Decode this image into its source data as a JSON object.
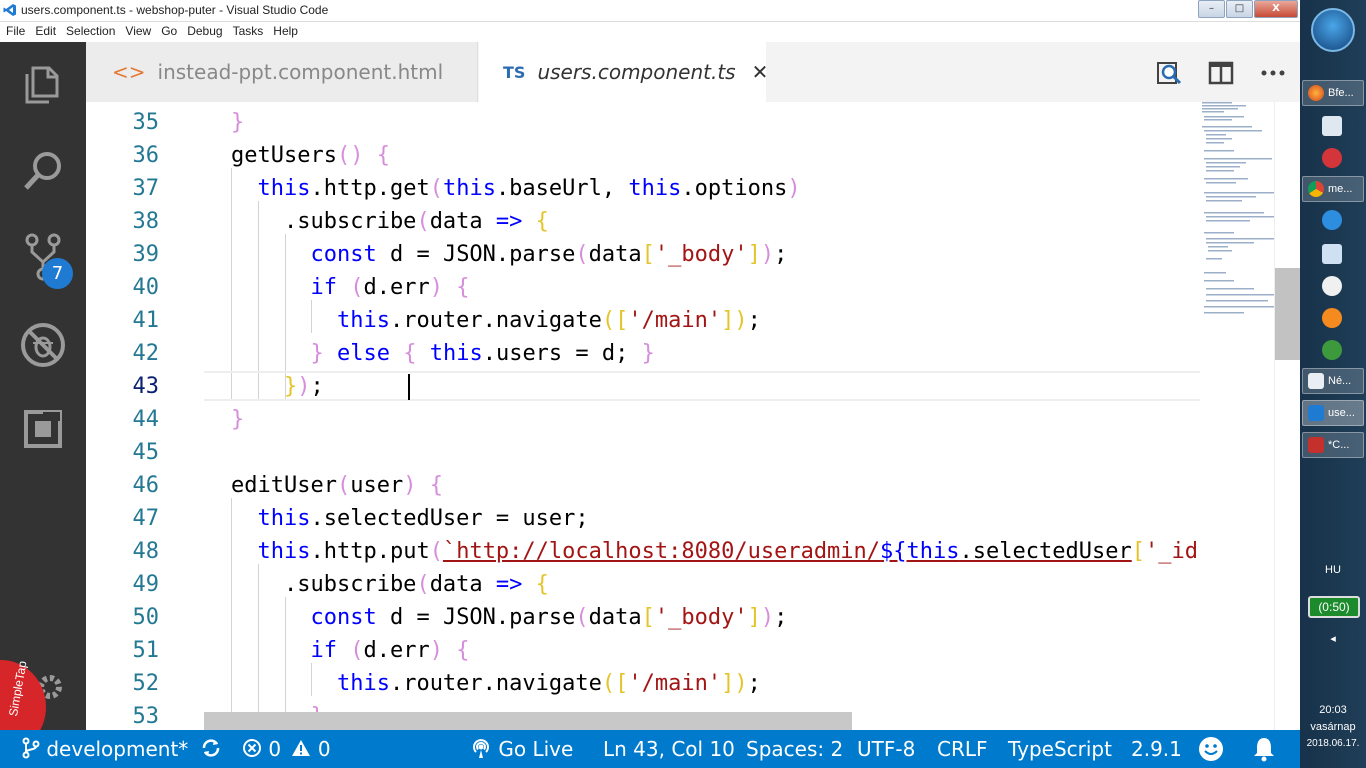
{
  "window": {
    "title": "users.component.ts - webshop-puter - Visual Studio Code",
    "controls": [
      "–",
      "□",
      "X"
    ]
  },
  "menu": [
    "File",
    "Edit",
    "Selection",
    "View",
    "Go",
    "Debug",
    "Tasks",
    "Help"
  ],
  "activity": {
    "scm_badge": "7",
    "simpletap_label": "SimpleTap"
  },
  "tabs": [
    {
      "label": "instead-ppt.component.html",
      "icon": "<>",
      "active": false
    },
    {
      "label": "users.component.ts",
      "icon": "TS",
      "active": true,
      "close": "✕"
    }
  ],
  "editor": {
    "current_line": 43,
    "lines": [
      {
        "n": "35"
      },
      {
        "n": "36"
      },
      {
        "n": "37"
      },
      {
        "n": "38"
      },
      {
        "n": "39"
      },
      {
        "n": "40"
      },
      {
        "n": "41"
      },
      {
        "n": "42"
      },
      {
        "n": "43"
      },
      {
        "n": "44"
      },
      {
        "n": "45"
      },
      {
        "n": "46"
      },
      {
        "n": "47"
      },
      {
        "n": "48"
      },
      {
        "n": "49"
      },
      {
        "n": "50"
      },
      {
        "n": "51"
      },
      {
        "n": "52"
      },
      {
        "n": "53"
      }
    ]
  },
  "status": {
    "branch": "development*",
    "errors": "0",
    "warnings": "0",
    "golive": "Go Live",
    "position": "Ln 43, Col 10",
    "spaces": "Spaces: 2",
    "encoding": "UTF-8",
    "eol": "CRLF",
    "language": "TypeScript",
    "version": "2.9.1"
  },
  "taskbar": {
    "items": [
      "Bfe...",
      "me...",
      "Né...",
      "use...",
      "*C..."
    ],
    "lang": "HU",
    "battery": "(0:50)",
    "time": "20:03",
    "day": "vasárnap",
    "date": "2018.06.17."
  },
  "colors": {
    "activitybar": "#333333",
    "statusbar": "#007acc",
    "keyword": "#0000ff",
    "string": "#a31515"
  }
}
